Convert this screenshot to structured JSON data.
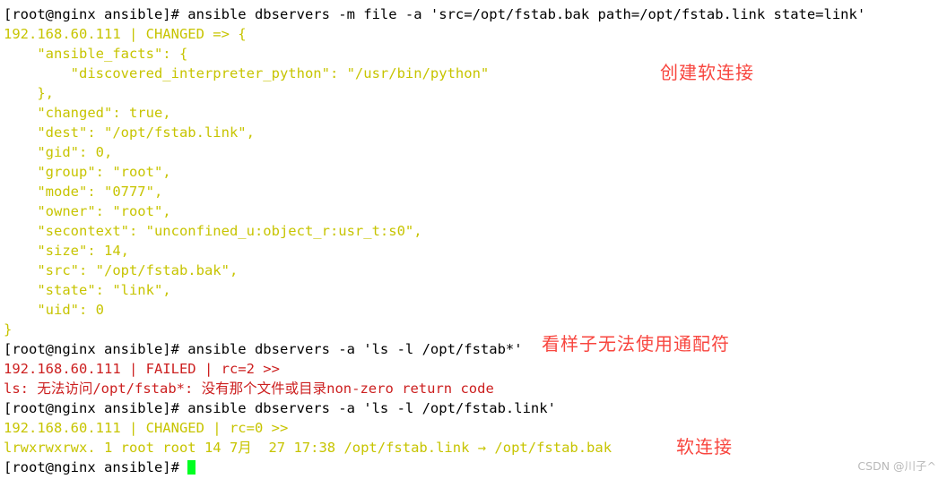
{
  "terminal": {
    "lines": [
      {
        "kind": "command",
        "text": "[root@nginx ansible]# ansible dbservers -m file -a 'src=/opt/fstab.bak path=/opt/fstab.link state=link'"
      },
      {
        "kind": "output",
        "text": "192.168.60.111 | CHANGED => {"
      },
      {
        "kind": "output",
        "text": "    \"ansible_facts\": {"
      },
      {
        "kind": "output",
        "text": "        \"discovered_interpreter_python\": \"/usr/bin/python\""
      },
      {
        "kind": "output",
        "text": "    },"
      },
      {
        "kind": "output",
        "text": "    \"changed\": true,"
      },
      {
        "kind": "output",
        "text": "    \"dest\": \"/opt/fstab.link\","
      },
      {
        "kind": "output",
        "text": "    \"gid\": 0,"
      },
      {
        "kind": "output",
        "text": "    \"group\": \"root\","
      },
      {
        "kind": "output",
        "text": "    \"mode\": \"0777\","
      },
      {
        "kind": "output",
        "text": "    \"owner\": \"root\","
      },
      {
        "kind": "output",
        "text": "    \"secontext\": \"unconfined_u:object_r:usr_t:s0\","
      },
      {
        "kind": "output",
        "text": "    \"size\": 14,"
      },
      {
        "kind": "output",
        "text": "    \"src\": \"/opt/fstab.bak\","
      },
      {
        "kind": "output",
        "text": "    \"state\": \"link\","
      },
      {
        "kind": "output",
        "text": "    \"uid\": 0"
      },
      {
        "kind": "output",
        "text": "}"
      },
      {
        "kind": "command",
        "text": "[root@nginx ansible]# ansible dbservers -a 'ls -l /opt/fstab*'"
      },
      {
        "kind": "error",
        "text": "192.168.60.111 | FAILED | rc=2 >>"
      },
      {
        "kind": "error",
        "text": "ls: 无法访问/opt/fstab*: 没有那个文件或目录non-zero return code"
      },
      {
        "kind": "command",
        "text": "[root@nginx ansible]# ansible dbservers -a 'ls -l /opt/fstab.link'"
      },
      {
        "kind": "output",
        "text": "192.168.60.111 | CHANGED | rc=0 >>"
      },
      {
        "kind": "output",
        "text": "lrwxrwxrwx. 1 root root 14 7月  27 17:38 /opt/fstab.link → /opt/fstab.bak"
      },
      {
        "kind": "prompt",
        "text": "[root@nginx ansible]# "
      }
    ]
  },
  "annotations": {
    "create_symlink": "创建软连接",
    "wildcard_not_supported": "看样子无法使用通配符",
    "symlink": "软连接"
  },
  "watermark": {
    "text": "CSDN @川子^"
  },
  "colors": {
    "command_text": "#000000",
    "output_text": "#c7c400",
    "error_text": "#cc1f1f",
    "annotation_red": "#f8463f",
    "cursor_green": "#00ff22",
    "background": "#ffffff",
    "watermark_gray": "#b9b9b9"
  }
}
